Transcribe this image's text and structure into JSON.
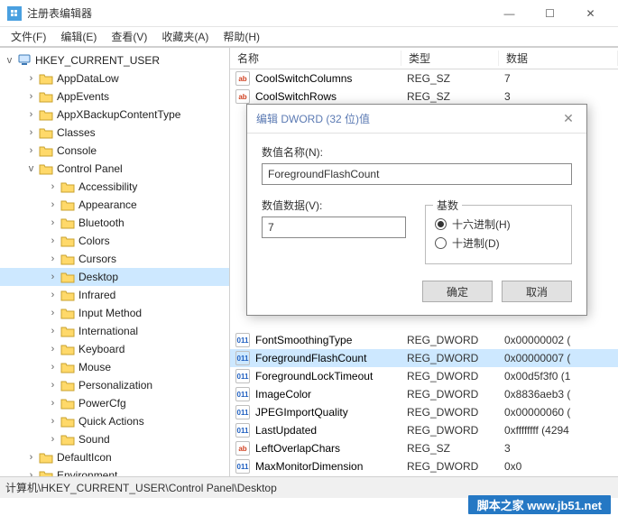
{
  "window": {
    "title": "注册表编辑器",
    "min": "—",
    "max": "☐",
    "close": "✕"
  },
  "menu": {
    "file": "文件(F)",
    "edit": "编辑(E)",
    "view": "查看(V)",
    "fav": "收藏夹(A)",
    "help": "帮助(H)"
  },
  "tree": {
    "root": "HKEY_CURRENT_USER",
    "items": [
      "AppDataLow",
      "AppEvents",
      "AppXBackupContentType",
      "Classes",
      "Console"
    ],
    "cp": "Control Panel",
    "cp_items": [
      "Accessibility",
      "Appearance",
      "Bluetooth",
      "Colors",
      "Cursors",
      "Desktop",
      "Infrared",
      "Input Method",
      "International",
      "Keyboard",
      "Mouse",
      "Personalization",
      "PowerCfg",
      "Quick Actions",
      "Sound"
    ],
    "tail": [
      "DefaultIcon",
      "Environment"
    ]
  },
  "list": {
    "cols": {
      "name": "名称",
      "type": "类型",
      "data": "数据"
    },
    "rows_top": [
      {
        "icon": "sz",
        "name": "CoolSwitchColumns",
        "type": "REG_SZ",
        "data": "7"
      },
      {
        "icon": "sz",
        "name": "CoolSwitchRows",
        "type": "REG_SZ",
        "data": "3"
      }
    ],
    "rows_bottom": [
      {
        "icon": "dw",
        "name": "FontSmoothingType",
        "type": "REG_DWORD",
        "data": "0x00000002 (",
        "sel": false
      },
      {
        "icon": "dw",
        "name": "ForegroundFlashCount",
        "type": "REG_DWORD",
        "data": "0x00000007 (",
        "sel": true
      },
      {
        "icon": "dw",
        "name": "ForegroundLockTimeout",
        "type": "REG_DWORD",
        "data": "0x00d5f3f0 (1",
        "sel": false
      },
      {
        "icon": "dw",
        "name": "ImageColor",
        "type": "REG_DWORD",
        "data": "0x8836aeb3 (",
        "sel": false
      },
      {
        "icon": "dw",
        "name": "JPEGImportQuality",
        "type": "REG_DWORD",
        "data": "0x00000060 (",
        "sel": false
      },
      {
        "icon": "dw",
        "name": "LastUpdated",
        "type": "REG_DWORD",
        "data": "0xffffffff (4294",
        "sel": false
      },
      {
        "icon": "sz",
        "name": "LeftOverlapChars",
        "type": "REG_SZ",
        "data": "3",
        "sel": false
      },
      {
        "icon": "dw",
        "name": "MaxMonitorDimension",
        "type": "REG_DWORD",
        "data": "0x0",
        "sel": false
      }
    ]
  },
  "dialog": {
    "title": "编辑 DWORD (32 位)值",
    "name_label": "数值名称(N):",
    "name_value": "ForegroundFlashCount",
    "data_label": "数值数据(V):",
    "data_value": "7",
    "base_label": "基数",
    "hex": "十六进制(H)",
    "dec": "十进制(D)",
    "ok": "确定",
    "cancel": "取消"
  },
  "status": "计算机\\HKEY_CURRENT_USER\\Control Panel\\Desktop",
  "watermark": "脚本之家 www.jb51.net"
}
